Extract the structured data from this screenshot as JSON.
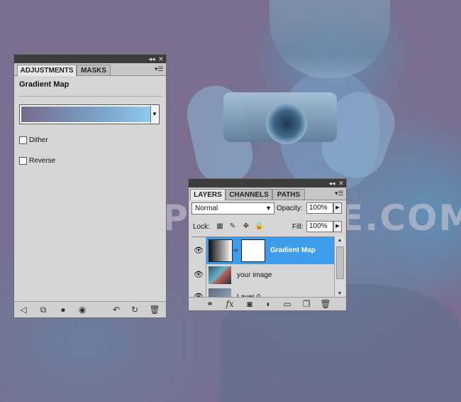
{
  "watermark": "WWW.PSDDUDE.COM",
  "adjustments": {
    "tabs": [
      "ADJUSTMENTS",
      "MASKS"
    ],
    "title": "Gradient Map",
    "gradient_colors": [
      "#776b8d",
      "#7aa2c8",
      "#8ccaec"
    ],
    "options": [
      {
        "label": "Dither",
        "checked": false
      },
      {
        "label": "Reverse",
        "checked": false
      }
    ],
    "footer_icons": [
      "back-arrow-icon",
      "clip-to-layer-icon",
      "layer-mask-icon",
      "visibility-eye-icon",
      "view-previous-icon",
      "reset-icon",
      "delete-icon"
    ]
  },
  "layers": {
    "tabs": [
      "LAYERS",
      "CHANNELS",
      "PATHS"
    ],
    "blend_mode": "Normal",
    "opacity_label": "Opacity:",
    "opacity_value": "100%",
    "lock_label": "Lock:",
    "fill_label": "Fill:",
    "fill_value": "100%",
    "items": [
      {
        "name": "Gradient Map",
        "selected": true
      },
      {
        "name": "your image",
        "selected": false
      },
      {
        "name": "Layer 0",
        "selected": false
      }
    ],
    "accent_color": "#3e9ced",
    "footer_icons": [
      "link-icon",
      "fx-icon",
      "mask-icon",
      "adjustment-icon",
      "folder-icon",
      "new-layer-icon",
      "trash-icon"
    ]
  }
}
